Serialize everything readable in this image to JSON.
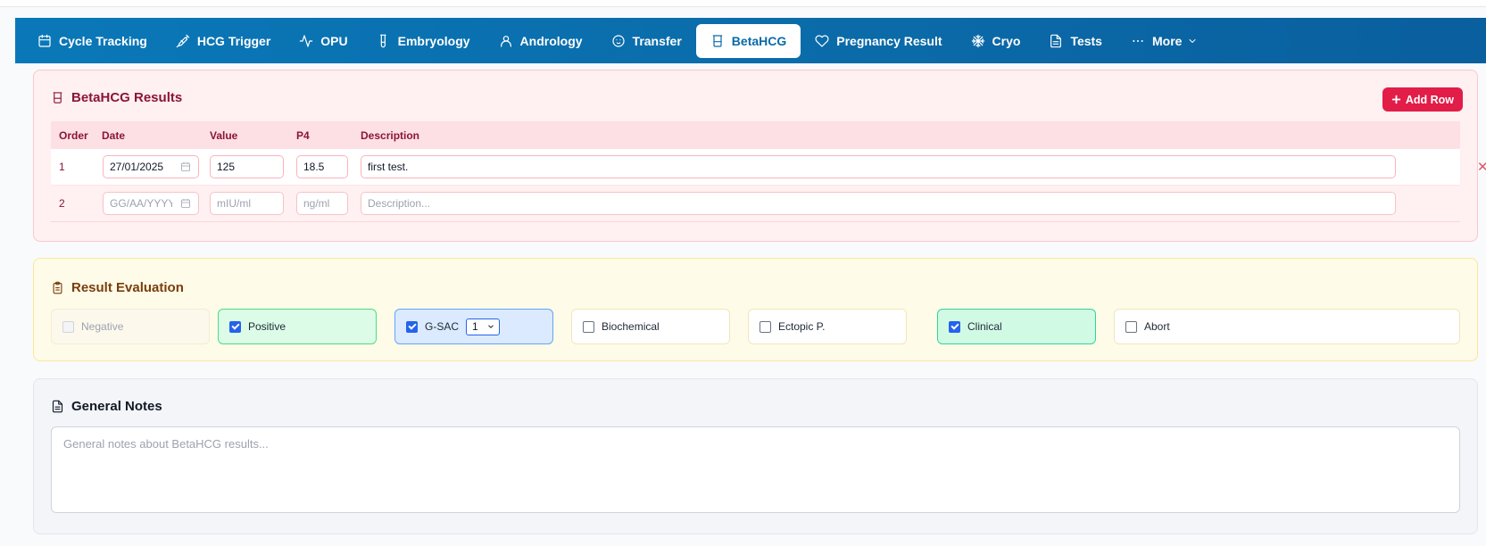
{
  "nav": {
    "items": [
      {
        "label": "Cycle Tracking",
        "icon": "calendar-icon"
      },
      {
        "label": "HCG Trigger",
        "icon": "syringe-icon"
      },
      {
        "label": "OPU",
        "icon": "activity-icon"
      },
      {
        "label": "Embryology",
        "icon": "test-tube-icon"
      },
      {
        "label": "Andrology",
        "icon": "user-icon"
      },
      {
        "label": "Transfer",
        "icon": "baby-icon"
      },
      {
        "label": "BetaHCG",
        "icon": "beaker-icon"
      },
      {
        "label": "Pregnancy Result",
        "icon": "heart-icon"
      },
      {
        "label": "Cryo",
        "icon": "snowflake-icon"
      },
      {
        "label": "Tests",
        "icon": "file-icon"
      },
      {
        "label": "More",
        "icon": "more-icon"
      }
    ],
    "active": "BetaHCG"
  },
  "beta": {
    "title": "BetaHCG Results",
    "add_row_label": "Add Row",
    "columns": [
      "Order",
      "Date",
      "Value",
      "P4",
      "Description"
    ],
    "rows": [
      {
        "order": "1",
        "date": "27/01/2025",
        "value": "125",
        "p4": "18.5",
        "description": "first test.",
        "removable": true
      },
      {
        "order": "2",
        "date_placeholder": "GG/AA/YYYY",
        "value_placeholder": "mIU/ml",
        "p4_placeholder": "ng/ml",
        "description_placeholder": "Description...",
        "removable": false
      }
    ],
    "delete_glyph": "✕"
  },
  "evaluation": {
    "title": "Result Evaluation",
    "options": [
      {
        "label": "Negative",
        "checked": false,
        "disabled": true
      },
      {
        "label": "Positive",
        "checked": true
      },
      {
        "label": "G-SAC",
        "checked": true,
        "select_value": "1"
      },
      {
        "label": "Biochemical",
        "checked": false
      },
      {
        "label": "Ectopic P.",
        "checked": false
      },
      {
        "label": "Clinical",
        "checked": true
      },
      {
        "label": "Abort",
        "checked": false
      }
    ]
  },
  "notes": {
    "title": "General Notes",
    "placeholder": "General notes about BetaHCG results..."
  },
  "colors": {
    "nav_bg": "#0a6aa8",
    "beta_accent": "#e11d48",
    "beta_text": "#8a1538",
    "eval_text": "#7a3e0c"
  }
}
